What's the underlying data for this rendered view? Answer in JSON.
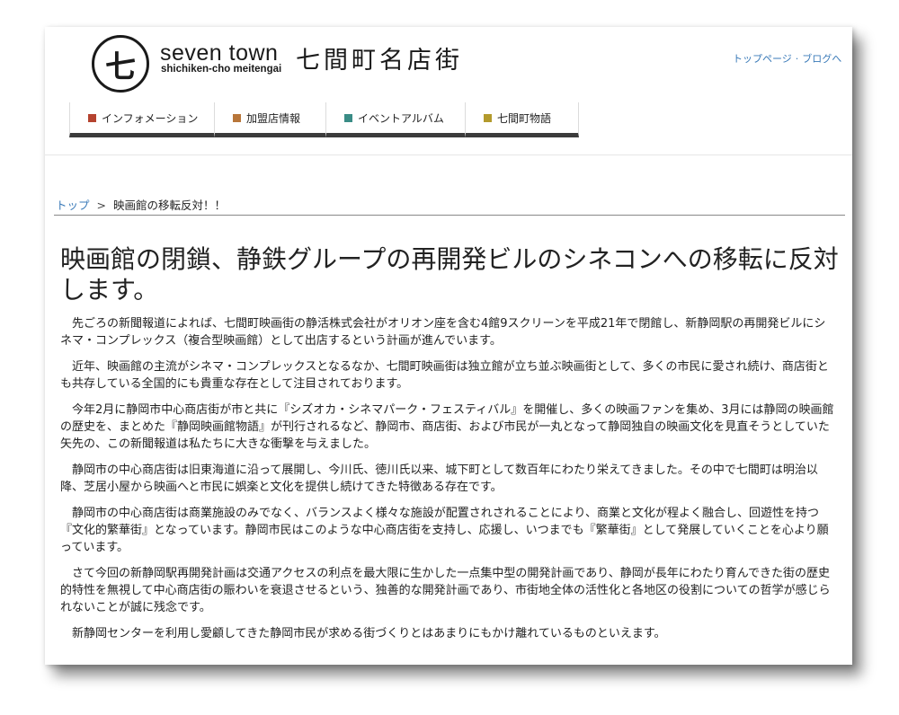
{
  "header": {
    "logo_mark": "七",
    "logo_en": "seven town",
    "logo_sub": "shichiken-cho meitengai",
    "logo_jp": "七間町名店街",
    "top_links": [
      "トップページ",
      "ブログへ"
    ]
  },
  "nav": [
    {
      "label": "インフォメーション",
      "color": "#b5432f"
    },
    {
      "label": "加盟店情報",
      "color": "#b8763a"
    },
    {
      "label": "イベントアルバム",
      "color": "#3a8c86"
    },
    {
      "label": "七間町物語",
      "color": "#b39a2c"
    }
  ],
  "breadcrumb": {
    "home": "トップ",
    "separator": ">",
    "current": "映画館の移転反対！！"
  },
  "article": {
    "title": "映画館の閉鎖、静鉄グループの再開発ビルのシネコンへの移転に反対します。",
    "paragraphs": [
      "先ごろの新聞報道によれば、七間町映画街の静活株式会社がオリオン座を含む4館9スクリーンを平成21年で閉館し、新静岡駅の再開発ビルにシネマ・コンプレックス（複合型映画館）として出店するという計画が進んでいます。",
      "近年、映画館の主流がシネマ・コンプレックスとなるなか、七間町映画街は独立館が立ち並ぶ映画街として、多くの市民に愛され続け、商店街とも共存している全国的にも貴重な存在として注目されております。",
      "今年2月に静岡市中心商店街が市と共に『シズオカ・シネマパーク・フェスティバル』を開催し、多くの映画ファンを集め、3月には静岡の映画館の歴史を、まとめた『静岡映画館物語』が刊行されるなど、静岡市、商店街、および市民が一丸となって静岡独自の映画文化を見直そうとしていた矢先の、この新聞報道は私たちに大きな衝撃を与えました。",
      "静岡市の中心商店街は旧東海道に沿って展開し、今川氏、徳川氏以来、城下町として数百年にわたり栄えてきました。その中で七間町は明治以降、芝居小屋から映画へと市民に娯楽と文化を提供し続けてきた特徴ある存在です。",
      "静岡市の中心商店街は商業施設のみでなく、バランスよく様々な施設が配置されされることにより、商業と文化が程よく融合し、回遊性を持つ『文化的繁華街』となっています。静岡市民はこのような中心商店街を支持し、応援し、いつまでも『繁華街』として発展していくことを心より願っています。",
      "さて今回の新静岡駅再開発計画は交通アクセスの利点を最大限に生かした一点集中型の開発計画であり、静岡が長年にわたり育んできた街の歴史的特性を無視して中心商店街の賑わいを衰退させるという、独善的な開発計画であり、市街地全体の活性化と各地区の役割についての哲学が感じられないことが誠に残念です。",
      "新静岡センターを利用し愛顧してきた静岡市民が求める街づくりとはあまりにもかけ離れているものといえます。"
    ]
  }
}
